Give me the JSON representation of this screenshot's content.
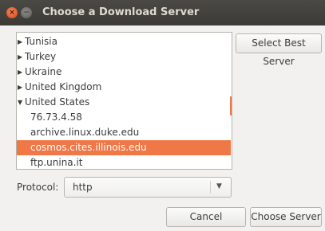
{
  "window": {
    "title": "Choose a Download Server",
    "close_glyph": "×",
    "min_glyph": "−"
  },
  "tree": {
    "rows": [
      {
        "label": "Tunisia",
        "type": "collapsed"
      },
      {
        "label": "Turkey",
        "type": "collapsed"
      },
      {
        "label": "Ukraine",
        "type": "collapsed"
      },
      {
        "label": "United Kingdom",
        "type": "collapsed"
      },
      {
        "label": "United States",
        "type": "expanded"
      },
      {
        "label": "76.73.4.58",
        "type": "child"
      },
      {
        "label": "archive.linux.duke.edu",
        "type": "child"
      },
      {
        "label": "cosmos.cites.illinois.edu",
        "type": "child",
        "selected": true
      },
      {
        "label": "ftp.unina.it",
        "type": "child"
      }
    ],
    "icons": {
      "collapsed": "expander-collapsed-icon",
      "expanded": "expander-expanded-icon"
    }
  },
  "buttons": {
    "select_best": "Select Best Server",
    "cancel": "Cancel",
    "choose": "Choose Server"
  },
  "protocol": {
    "label": "Protocol:",
    "value": "http"
  },
  "colors": {
    "accent": "#f07746",
    "titlebar": "#3b3a36",
    "window_bg": "#f2f1f0"
  }
}
